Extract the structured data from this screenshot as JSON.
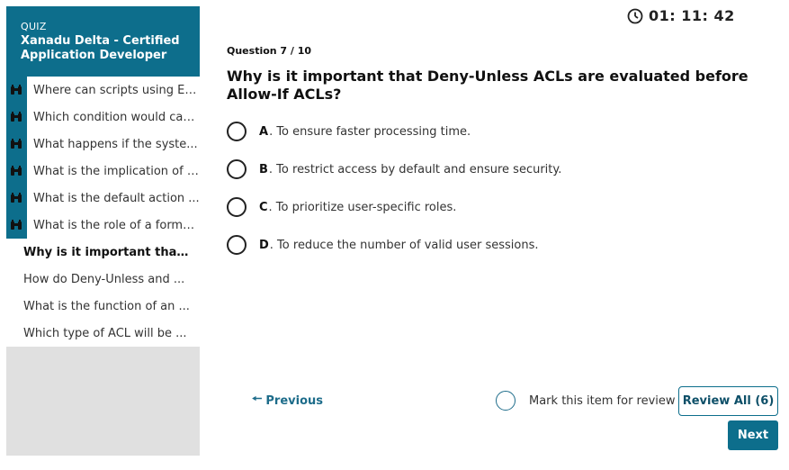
{
  "sidebar": {
    "kicker": "QUIZ",
    "title": "Xanadu Delta - Certified Application Developer",
    "items": [
      {
        "label": "Where can scripts using EC...",
        "state": "done"
      },
      {
        "label": "Which condition would cau...",
        "state": "done"
      },
      {
        "label": "What happens if the syste...",
        "state": "done"
      },
      {
        "label": "What is the implication of E...",
        "state": "done"
      },
      {
        "label": "What is the default action ...",
        "state": "done"
      },
      {
        "label": "What is the role of a format...",
        "state": "done"
      },
      {
        "label": "Why is it important that D...",
        "state": "current"
      },
      {
        "label": "How do Deny-Unless and ...",
        "state": "plain"
      },
      {
        "label": "What is the function of an ...",
        "state": "plain"
      },
      {
        "label": "Which type of ACL will be ...",
        "state": "plain"
      }
    ]
  },
  "timer": {
    "text": "01: 11: 42",
    "icon": "clock-icon"
  },
  "question": {
    "counter": "Question 7 / 10",
    "text": "Why is it important that Deny-Unless ACLs are evaluated before Allow-If ACLs?",
    "options": [
      {
        "letter": "A",
        "text": ". To ensure faster processing time."
      },
      {
        "letter": "B",
        "text": ". To restrict access by default and ensure security."
      },
      {
        "letter": "C",
        "text": ". To prioritize user-specific roles."
      },
      {
        "letter": "D",
        "text": ". To reduce the number of valid user sessions."
      }
    ]
  },
  "controls": {
    "previous_arrow": "🠔",
    "previous_label": "Previous",
    "mark_label": "Mark this item for review",
    "review_label": "Review All (6)",
    "next_label": "Next"
  },
  "colors": {
    "accent": "#0d6e8c",
    "sidebar_bg": "#e0e0e0"
  }
}
